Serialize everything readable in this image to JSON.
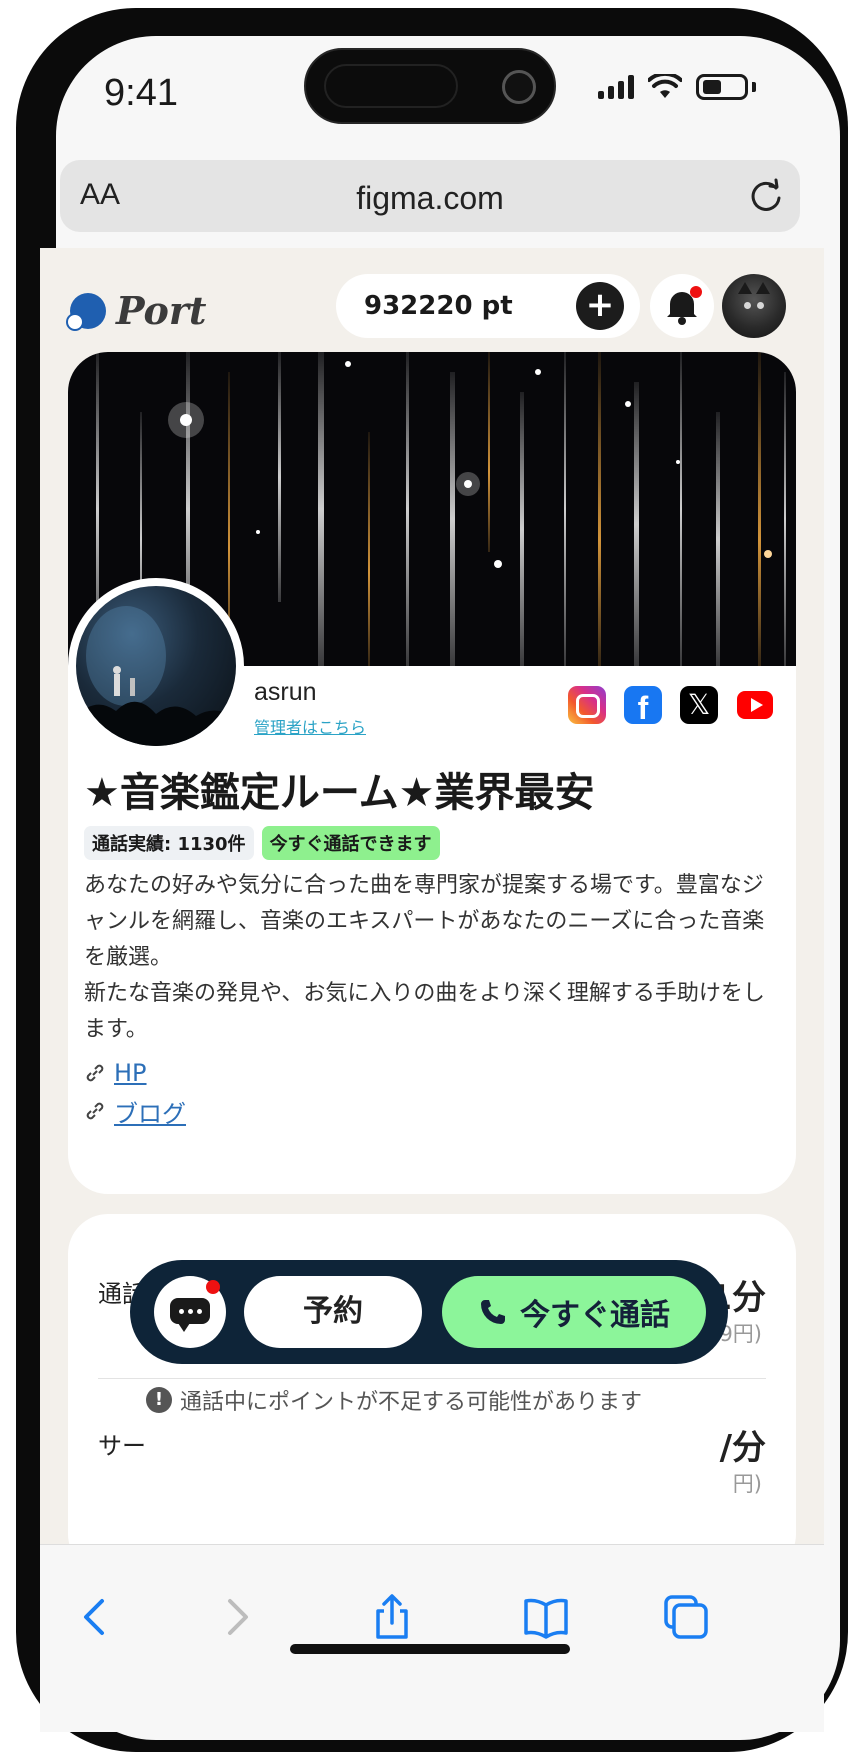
{
  "status_bar": {
    "time": "9:41"
  },
  "browser": {
    "text_size_label": "AA",
    "url": "figma.com"
  },
  "header": {
    "logo_text": "Port",
    "points": "932220 pt"
  },
  "profile": {
    "name": "asrun",
    "admin_link": "管理者はこちら",
    "room_title": "★音楽鑑定ルーム★業界最安",
    "call_record_badge": "通話実績: 1130件",
    "available_badge": "今すぐ通話できます",
    "description": "あなたの好みや気分に合った曲を専門家が提案する場です。豊富なジャンルを網羅し、音楽のエキスパートがあなたのニーズに合った音楽を厳選。\n新たな音楽の発見や、お気に入りの曲をより深く理解する手助けをします。",
    "links": [
      {
        "label": "HP"
      },
      {
        "label": "ブログ"
      }
    ],
    "socials": [
      "instagram-icon",
      "facebook-icon",
      "x-icon",
      "youtube-icon"
    ]
  },
  "pricing": {
    "rows": [
      {
        "label": "通話料",
        "value": "81 pt/1分",
        "tax": "(税込89円)"
      },
      {
        "label": "サー",
        "value": "/分",
        "tax": "円)"
      }
    ],
    "warning": "通話中にポイントが不足する可能性があります"
  },
  "action_bar": {
    "reserve_label": "予約",
    "call_label": "今すぐ通話"
  },
  "colors": {
    "accent_green": "#8cf59a",
    "action_bar_bg": "#0e2438",
    "logo_blue": "#1f5fb0",
    "link_blue": "#2c6fb8"
  }
}
